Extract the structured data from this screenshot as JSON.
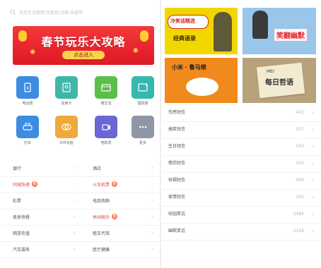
{
  "left": {
    "search": {
      "placeholder": "查找生活缴费/优惠券/违章/快递等"
    },
    "banner": {
      "title": "春节玩乐大攻略",
      "button": "点击进入"
    },
    "grid": [
      {
        "label": "电话费",
        "icon": "phone-bill-icon",
        "color": "#3d8ce2"
      },
      {
        "label": "信用卡",
        "icon": "credit-card-icon",
        "color": "#3fb7a7"
      },
      {
        "label": "缴生活",
        "icon": "wallet-icon",
        "color": "#5bbf4b"
      },
      {
        "label": "理财通",
        "icon": "finance-icon",
        "color": "#35b8ae"
      },
      {
        "label": "打车",
        "icon": "taxi-icon",
        "color": "#3d8ce2"
      },
      {
        "label": "Q币充值",
        "icon": "coin-icon",
        "color": "#f0a93b"
      },
      {
        "label": "电影票",
        "icon": "movie-icon",
        "color": "#6b66d4"
      },
      {
        "label": "更多",
        "icon": "more-icon",
        "color": "#8e96a7"
      }
    ],
    "list": [
      [
        {
          "label": "银行",
          "red": false,
          "badge": ""
        },
        {
          "label": "酒店",
          "red": false,
          "badge": ""
        }
      ],
      [
        {
          "label": "同城快递",
          "red": true,
          "badge": "惠"
        },
        {
          "label": "火车机票",
          "red": true,
          "badge": "惠"
        }
      ],
      [
        {
          "label": "彩票",
          "red": false,
          "badge": ""
        },
        {
          "label": "电商购物",
          "red": false,
          "badge": ""
        }
      ],
      [
        {
          "label": "美食快餐",
          "red": false,
          "badge": ""
        },
        {
          "label": "休闲娱乐",
          "red": true,
          "badge": "惠"
        }
      ],
      [
        {
          "label": "网游充值",
          "red": false,
          "badge": ""
        },
        {
          "label": "租车代驾",
          "red": false,
          "badge": ""
        }
      ],
      [
        {
          "label": "汽车服务",
          "red": false,
          "badge": ""
        },
        {
          "label": "医疗健康",
          "red": false,
          "badge": ""
        }
      ]
    ]
  },
  "right": {
    "tiles": [
      {
        "caption": "经典语录",
        "logo": "冷笑话精选",
        "bg": "#f2d600"
      },
      {
        "caption": "笑翻幽默",
        "bg": "#9ac6ea"
      },
      {
        "caption": "小米 · 鲁马想",
        "bg": "#f08a1c"
      },
      {
        "caption": "每日哲语",
        "sub": "MEI",
        "bg": "#b8a27b"
      }
    ],
    "list": [
      {
        "name": "伤感短信",
        "count": "441"
      },
      {
        "name": "搞笑短信",
        "count": "537"
      },
      {
        "name": "生日短信",
        "count": "543"
      },
      {
        "name": "情侣短信",
        "count": "550"
      },
      {
        "name": "祝福短信",
        "count": "409"
      },
      {
        "name": "爱情短信",
        "count": "305"
      },
      {
        "name": "校园笑话",
        "count": "2485"
      },
      {
        "name": "幽默笑话",
        "count": "2158"
      }
    ]
  }
}
